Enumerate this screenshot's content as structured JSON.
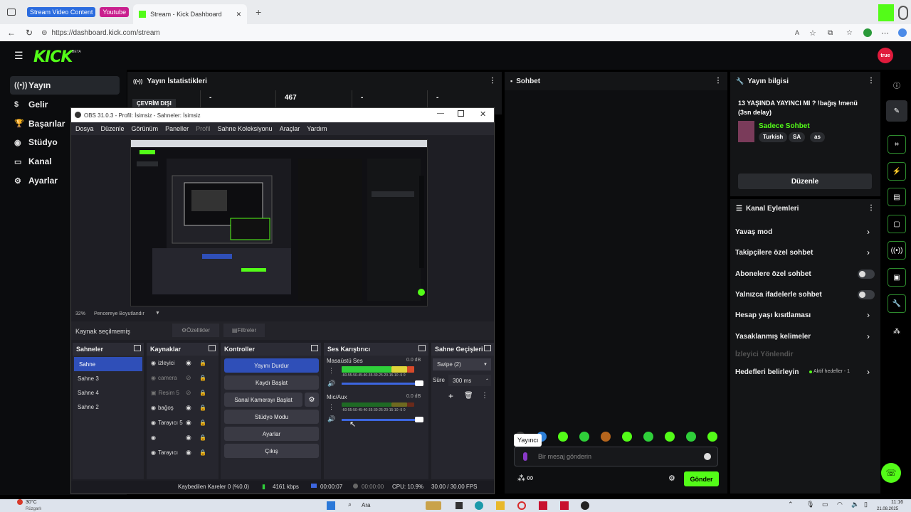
{
  "browser": {
    "tab1": "Stream Video Content",
    "tab2": "Youtube",
    "active_tab": "Stream - Kick Dashboard",
    "url": "https://dashboard.kick.com/stream",
    "new_tab": "+",
    "close_tab": "✕"
  },
  "kick": {
    "logo": "KICK",
    "beta": "BETA",
    "avatar_text": "true",
    "sidebar": [
      {
        "icon": "((•))",
        "label": "Yayın"
      },
      {
        "icon": "$",
        "label": "Gelir"
      },
      {
        "icon": "🏆",
        "label": "Başarılar"
      },
      {
        "icon": "◉",
        "label": "Stüdyo"
      },
      {
        "icon": "▭",
        "label": "Kanal"
      },
      {
        "icon": "⚙",
        "label": "Ayarlar"
      }
    ]
  },
  "stats_panel": {
    "title": "Yayın İstatistikleri",
    "status": "ÇEVRİM DIŞI",
    "v1": "-",
    "v2": "467",
    "v3": "-",
    "v4": "-"
  },
  "chat_panel": {
    "title": "Sohbet",
    "badge": "Yayıncı",
    "placeholder": "Bir mesaj gönderin",
    "send": "Gönder",
    "infinity": "∞"
  },
  "info_panel": {
    "title": "Yayın bilgisi",
    "stream_title": "13 YAŞINDA YAYINCI MI ? !bağış !menü (3sn delay)",
    "category": "Sadece Sohbet",
    "tags": [
      "Turkish",
      "SA",
      "as"
    ],
    "edit": "Düzenle"
  },
  "actions_panel": {
    "title": "Kanal Eylemleri",
    "items": [
      "Yavaş mod",
      "Takipçilere özel sohbet",
      "Abonelere özel sohbet",
      "Yalnızca ifadelerle sohbet",
      "Hesap yaşı kısıtlaması",
      "Yasaklanmış kelimeler",
      "İzleyici Yönlendir",
      "Hedefleri belirleyin"
    ],
    "goals_status": "Aktif hedefler - 1"
  },
  "obs": {
    "title": "OBS 31.0.3 - Profil: İsimsiz - Sahneler: İsimsiz",
    "menu": [
      "Dosya",
      "Düzenle",
      "Görünüm",
      "Paneller",
      "Profil",
      "Sahne Koleksiyonu",
      "Araçlar",
      "Yardım"
    ],
    "zoom": "32%",
    "fit": "Pencereye Boyutlandır",
    "no_source": "Kaynak seçilmemiş",
    "properties": "Özellikler",
    "filters": "Filtreler",
    "scenes_title": "Sahneler",
    "scenes": [
      "Sahne",
      "Sahne 3",
      "Sahne 4",
      "Sahne 2"
    ],
    "sources_title": "Kaynaklar",
    "sources": [
      "izleyici",
      "camera",
      "Resim 5",
      "bağoş",
      "Tarayıcı 5",
      "",
      "Tarayıcı"
    ],
    "controls_title": "Kontroller",
    "controls": [
      "Yayını Durdur",
      "Kaydı Başlat",
      "Sanal Kamerayı Başlat",
      "Stüdyo Modu",
      "Ayarlar",
      "Çıkış"
    ],
    "mixer_title": "Ses Karıştırıcı",
    "ch1": "Masaüstü Ses",
    "ch1_db": "0.0 dB",
    "ch2": "Mic/Aux",
    "ch2_db": "0.0 dB",
    "scale": "-60-55-50-45-40-35-30-25-20-15-10 -5  0",
    "trans_title": "Sahne Geçişleri",
    "transition": "Swipe (2)",
    "duration_label": "Süre",
    "duration": "300 ms",
    "dropped": "Kaybedilen Kareler 0 (%0.0)",
    "kbps": "4161 kbps",
    "live_time": "00:00:07",
    "rec_time": "00:00:00",
    "cpu": "CPU: 10.9%",
    "fps": "30.00 / 30.00 FPS"
  },
  "taskbar": {
    "temp": "30°C",
    "weather": "Rüzgarlı",
    "search": "Ara",
    "time": "11:16",
    "date": "21.08.2025"
  },
  "colors": {
    "kick_green": "#53fc18",
    "obs_blue": "#2f4fb8"
  }
}
